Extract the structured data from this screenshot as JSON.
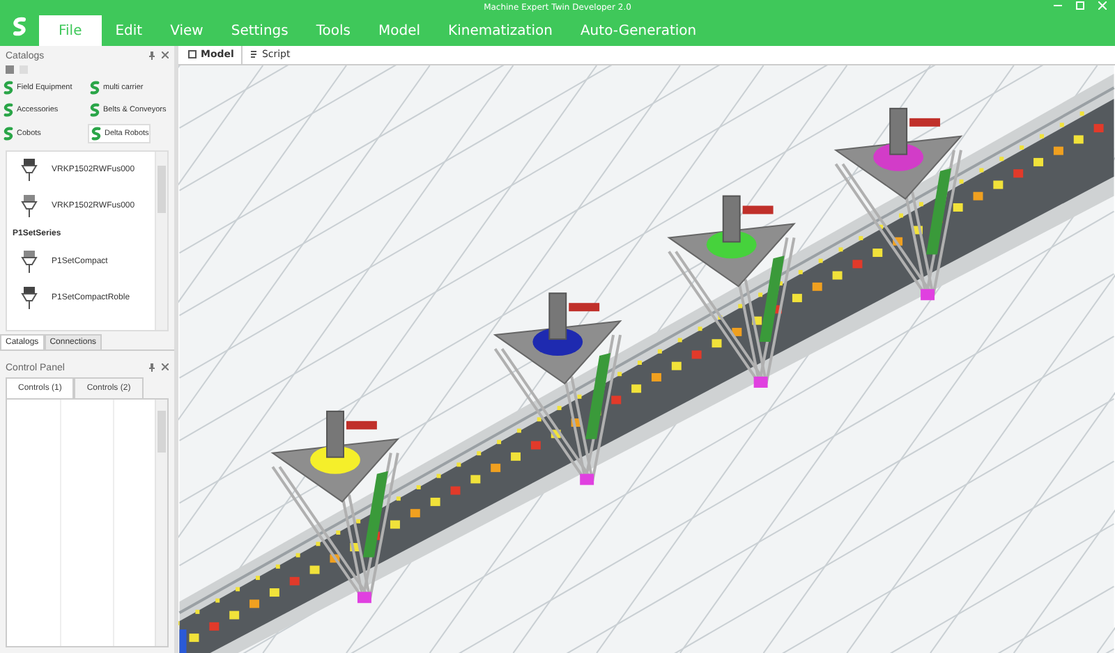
{
  "window": {
    "title": "Machine Expert Twin Developer 2.0"
  },
  "menu": [
    {
      "label": "File",
      "selected": true
    },
    {
      "label": "Edit",
      "selected": false
    },
    {
      "label": "View",
      "selected": false
    },
    {
      "label": "Settings",
      "selected": false
    },
    {
      "label": "Tools",
      "selected": false
    },
    {
      "label": "Model",
      "selected": false
    },
    {
      "label": "Kinematization",
      "selected": false
    },
    {
      "label": "Auto-Generation",
      "selected": false
    }
  ],
  "catalogs": {
    "title": "Catalogs",
    "categories": [
      {
        "label": "Field Equipment",
        "selected": false
      },
      {
        "label": "multi carrier",
        "selected": false
      },
      {
        "label": "Accessories",
        "selected": false
      },
      {
        "label": "Belts & Conveyors",
        "selected": false
      },
      {
        "label": "Cobots",
        "selected": false
      },
      {
        "label": "Delta Robots",
        "selected": true
      }
    ],
    "items": [
      {
        "kind": "item",
        "label": "VRKP1502RWFus000"
      },
      {
        "kind": "item",
        "label": "VRKP1502RWFus000"
      },
      {
        "kind": "group",
        "label": "P1SetSeries"
      },
      {
        "kind": "item",
        "label": "P1SetCompact"
      },
      {
        "kind": "item",
        "label": "P1SetCompactRoble"
      }
    ]
  },
  "panel_tabs": [
    {
      "label": "Catalogs",
      "selected": true
    },
    {
      "label": "Connections",
      "selected": false
    }
  ],
  "control_panel": {
    "title": "Control Panel",
    "tabs": [
      {
        "label": "Controls (1)",
        "selected": true
      },
      {
        "label": "Controls (2)",
        "selected": false
      }
    ]
  },
  "view_tabs": [
    {
      "label": "Model",
      "selected": true
    },
    {
      "label": "Script",
      "selected": false
    }
  ]
}
